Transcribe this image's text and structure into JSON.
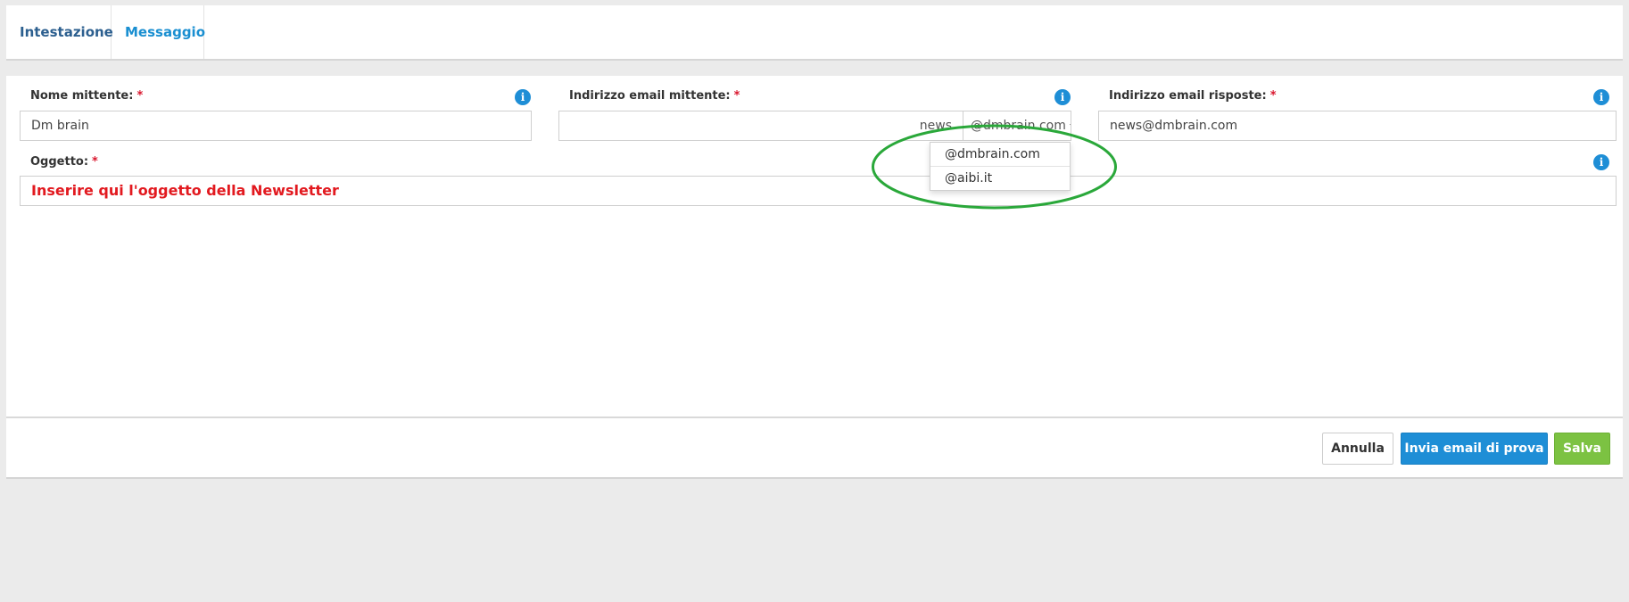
{
  "tabs": [
    {
      "label": "Intestazione"
    },
    {
      "label": "Messaggio"
    }
  ],
  "form": {
    "sender_name": {
      "label": "Nome mittente:",
      "required_mark": "*",
      "value": "Dm brain"
    },
    "sender_email": {
      "label": "Indirizzo email mittente:",
      "required_mark": "*",
      "local_part": "news",
      "selected_domain": "@dmbrain.com",
      "domain_options": [
        "@dmbrain.com",
        "@aibi.it"
      ]
    },
    "reply_email": {
      "label": "Indirizzo email risposte:",
      "required_mark": "*",
      "value": "news@dmbrain.com"
    },
    "subject": {
      "label": "Oggetto:",
      "required_mark": "*",
      "value": "Inserire qui l'oggetto della Newsletter"
    }
  },
  "icons": {
    "info_glyph": "i"
  },
  "buttons": {
    "cancel": "Annulla",
    "send_test": "Invia email di prova",
    "save": "Salva"
  },
  "colors": {
    "accent_blue": "#1e8ed6",
    "save_green": "#7cc242",
    "required_red": "#d9162d",
    "annotation_green": "#2aa83a"
  }
}
